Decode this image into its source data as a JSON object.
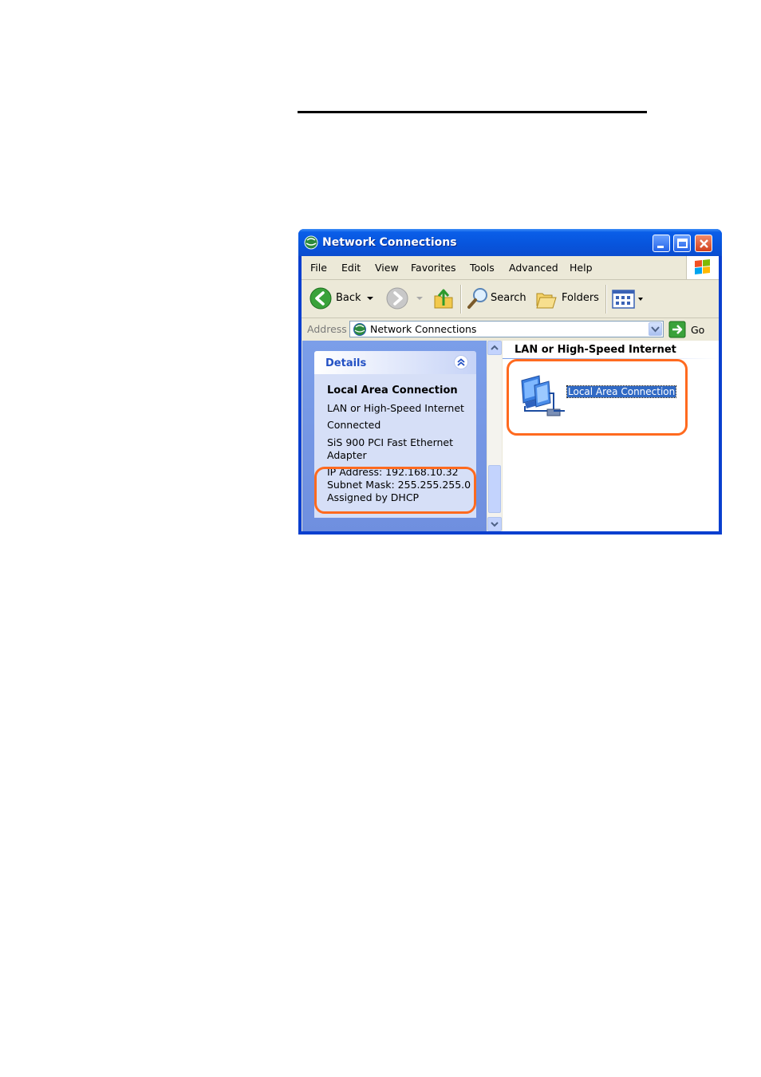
{
  "window": {
    "title": "Network Connections"
  },
  "menu": {
    "items": [
      "File",
      "Edit",
      "View",
      "Favorites",
      "Tools",
      "Advanced",
      "Help"
    ]
  },
  "toolbar": {
    "back": "Back",
    "search": "Search",
    "folders": "Folders"
  },
  "address": {
    "label": "Address",
    "value": "Network Connections",
    "go": "Go"
  },
  "details": {
    "title": "Details",
    "name": "Local Area Connection",
    "type": "LAN or High-Speed Internet",
    "status": "Connected",
    "adapter_line1": "SiS 900 PCI Fast Ethernet",
    "adapter_line2": "Adapter",
    "ip": "IP Address: 192.168.10.32",
    "subnet": "Subnet Mask: 255.255.255.0",
    "assigned": "Assigned by DHCP"
  },
  "content": {
    "group_title": "LAN or High-Speed Internet",
    "item_label": "Local Area Connection"
  },
  "colors": {
    "highlight": "#ff6a1f",
    "title_bar": "#0855dd",
    "selection": "#316ac5"
  },
  "icons": [
    "network-connections-icon",
    "minimize-icon",
    "maximize-icon",
    "close-icon",
    "windows-logo-icon",
    "back-arrow-icon",
    "forward-arrow-icon",
    "up-folder-icon",
    "search-icon",
    "folders-icon",
    "views-icon",
    "go-arrow-icon",
    "collapse-chevron-icon",
    "lan-connection-icon"
  ]
}
